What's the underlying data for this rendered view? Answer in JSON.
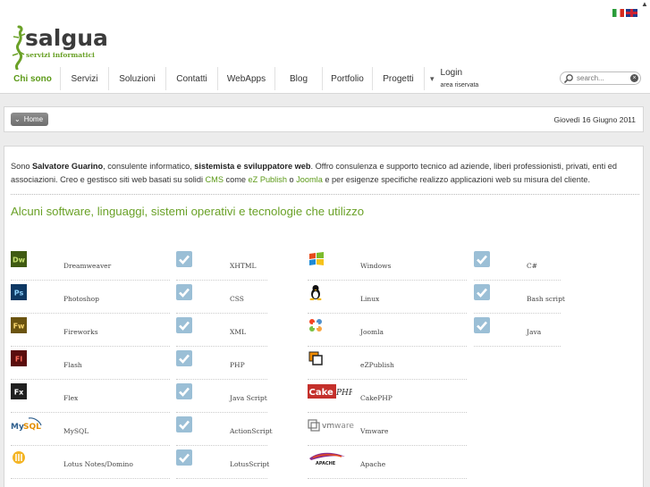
{
  "header": {
    "logo_text": "salgua",
    "logo_sub": "servizi informatici",
    "flags": [
      "italian-flag",
      "english-flag"
    ]
  },
  "nav": {
    "items": [
      {
        "label": "Chi sono",
        "active": true
      },
      {
        "label": "Servizi"
      },
      {
        "label": "Soluzioni"
      },
      {
        "label": "Contatti"
      },
      {
        "label": "WebApps"
      },
      {
        "label": "Blog"
      },
      {
        "label": "Portfolio"
      },
      {
        "label": "Progetti"
      }
    ],
    "login_label": "Login",
    "login_sub": "area riservata"
  },
  "search": {
    "placeholder": "search..."
  },
  "breadcrumb": {
    "home_label": "Home",
    "date": "Giovedì 16 Giugno 2011"
  },
  "intro": {
    "t1": "Sono ",
    "name": "Salvatore Guarino",
    "t2": ", consulente informatico, ",
    "role": "sistemista e sviluppatore web",
    "t3": ". Offro consulenza e supporto tecnico ad aziende, liberi professionisti, privati, enti ed associazioni. Creo e gestisco siti web basati su solidi ",
    "cms": "CMS",
    "t4": " come ",
    "ezpublish": "eZ Publish",
    "t5": " o ",
    "joomla": "Joomla",
    "t6": " e per esigenze specifiche realizzo applicazioni web su misura del cliente."
  },
  "section_title": "Alcuni software, linguaggi, sistemi operativi e tecnologie che utilizzo",
  "columns": [
    [
      {
        "icon": "dreamweaver-icon",
        "label": "Dreamweaver"
      },
      {
        "icon": "photoshop-icon",
        "label": "Photoshop"
      },
      {
        "icon": "fireworks-icon",
        "label": "Fireworks"
      },
      {
        "icon": "flash-icon",
        "label": "Flash"
      },
      {
        "icon": "flex-icon",
        "label": "Flex"
      },
      {
        "icon": "mysql-icon",
        "label": "MySQL"
      },
      {
        "icon": "lotus-notes-icon",
        "label": "Lotus Notes/Domino"
      }
    ],
    [
      {
        "icon": "check-icon",
        "label": "XHTML"
      },
      {
        "icon": "check-icon",
        "label": "CSS"
      },
      {
        "icon": "check-icon",
        "label": "XML"
      },
      {
        "icon": "check-icon",
        "label": "PHP"
      },
      {
        "icon": "check-icon",
        "label": "Java Script"
      },
      {
        "icon": "check-icon",
        "label": "ActionScript"
      },
      {
        "icon": "check-icon",
        "label": "LotusScript"
      }
    ],
    [
      {
        "icon": "windows-icon",
        "label": "Windows"
      },
      {
        "icon": "linux-icon",
        "label": "Linux"
      },
      {
        "icon": "joomla-icon",
        "label": "Joomla"
      },
      {
        "icon": "ezpublish-icon",
        "label": "eZPublish"
      },
      {
        "icon": "cakephp-icon",
        "label": "CakePHP"
      },
      {
        "icon": "vmware-icon",
        "label": "Vmware"
      },
      {
        "icon": "apache-icon",
        "label": "Apache"
      }
    ],
    [
      {
        "icon": "check-icon",
        "label": "C#"
      },
      {
        "icon": "check-icon",
        "label": "Bash script"
      },
      {
        "icon": "check-icon",
        "label": "Java"
      }
    ]
  ],
  "colors": {
    "accent": "#6aa127",
    "nav_active": "#5c9a18",
    "check_bg": "#9bbfd6"
  }
}
